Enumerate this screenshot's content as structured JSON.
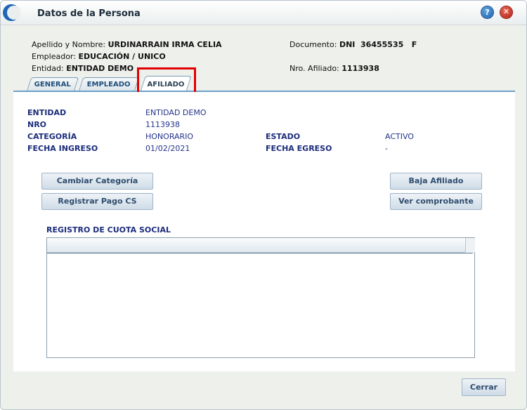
{
  "window": {
    "title": "Datos de la Persona",
    "help_label": "?",
    "close_label": "✕"
  },
  "person": {
    "nombre_label": "Apellido y Nombre:",
    "nombre_value": "URDINARRAIN IRMA CELIA",
    "empleador_label": "Empleador:",
    "empleador_value": "EDUCACIÓN / UNICO",
    "entidad_label": "Entidad:",
    "entidad_value": "ENTIDAD DEMO",
    "documento_label": "Documento:",
    "documento_value": "DNI  36455535   F",
    "afiliado_label": "Nro. Afiliado:",
    "afiliado_value": "1113938"
  },
  "tabs": [
    {
      "label": "GENERAL",
      "active": false
    },
    {
      "label": "EMPLEADO",
      "active": false
    },
    {
      "label": "AFILIADO",
      "active": true
    }
  ],
  "afiliado": {
    "entidad_label": "ENTIDAD",
    "entidad_value": "ENTIDAD DEMO",
    "nro_label": "NRO",
    "nro_value": "1113938",
    "categoria_label": "CATEGORÍA",
    "categoria_value": "HONORARIO",
    "estado_label": "ESTADO",
    "estado_value": "ACTIVO",
    "fecha_ingreso_label": "FECHA INGRESO",
    "fecha_ingreso_value": "01/02/2021",
    "fecha_egreso_label": "FECHA EGRESO",
    "fecha_egreso_value": "-"
  },
  "buttons": {
    "cambiar_categoria": "Cambiar Categoría",
    "registrar_pago": "Registrar Pago CS",
    "baja_afiliado": "Baja Afiliado",
    "ver_comprobante": "Ver comprobante",
    "cerrar": "Cerrar"
  },
  "registro": {
    "title": "REGISTRO DE CUOTA SOCIAL",
    "rows": []
  },
  "colors": {
    "accent": "#1b2c7a",
    "tab_border": "#6aa0c8",
    "highlight": "#e00000"
  }
}
